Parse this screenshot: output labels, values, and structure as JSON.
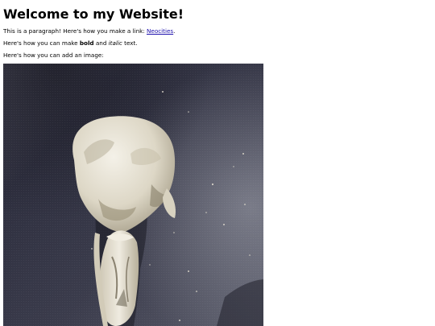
{
  "heading": "Welcome to my Website!",
  "paragraph1": {
    "before": "This is a paragraph! Here's how you make a link: ",
    "link_text": "Neocities",
    "after": "."
  },
  "paragraph2": {
    "before": "Here's how you can make ",
    "bold": "bold",
    "middle": " and ",
    "italic": "italic",
    "after": " text."
  },
  "paragraph3": "Here's how you can add an image:",
  "image": {
    "subject": "bird skull on dark fabric",
    "colors": {
      "fabric": "#3a3b4a",
      "bone": "#e6e1d2"
    }
  }
}
